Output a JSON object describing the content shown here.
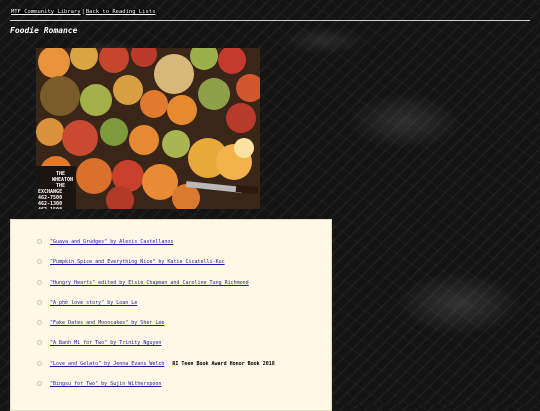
{
  "nav": {
    "library_link": "MTF Community Library",
    "separator": "|",
    "back_link": "Back to Reading Lists"
  },
  "page": {
    "title": "Foodie Romance"
  },
  "cover": {
    "sign_lines": [
      "THE",
      "WHEATON",
      "THE",
      "EXCHANGE",
      "462-7500",
      "462-1300",
      "462-1508"
    ]
  },
  "books": [
    {
      "title": "\"Guava and Grudges\" by Alexis Castellanos",
      "note": ""
    },
    {
      "title": "\"Pumpkin Spice and Everything Nice\" by Katie Cicatelli-Kuc",
      "note": ""
    },
    {
      "title": "\"Hungry Hearts\" edited by Elsie Chapman and Caroline Tung Richmond",
      "note": ""
    },
    {
      "title": "\"A phở love story\" by Loan Le",
      "note": ""
    },
    {
      "title": "\"Fake Dates and Mooncakes\" by Sher Lee",
      "note": ""
    },
    {
      "title": "\"A Banh Mi for Two\" by Trinity Nguyen",
      "note": ""
    },
    {
      "title": "\"Love and Gelato\" by Jenna Evans Welch",
      "note": "RI Teen Book Award Honor Book 2018"
    },
    {
      "title": "\"Bingsu for Two\" by Sujin Witherspoon",
      "note": ""
    }
  ],
  "colors": {
    "link": "#1a1aa6",
    "panel_bg": "#fff8e6",
    "page_bg": "#141414"
  }
}
